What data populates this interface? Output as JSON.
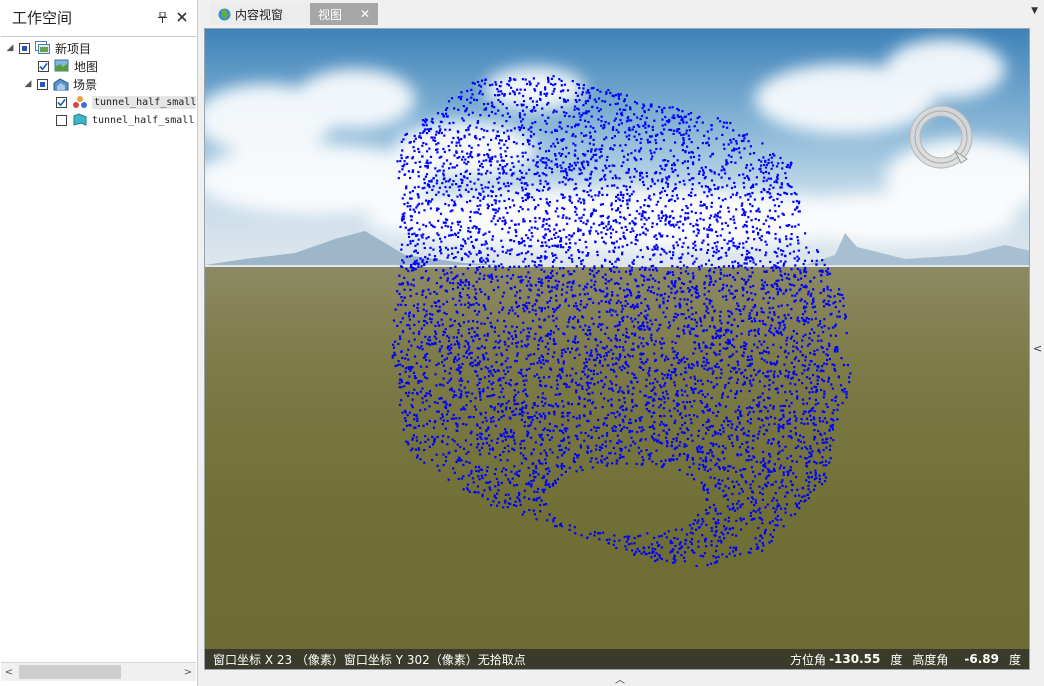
{
  "workspace": {
    "title": "工作空间",
    "pin_icon": "pin-icon",
    "close_icon": "close-icon"
  },
  "tree": {
    "project": "新项目",
    "map": "地图",
    "scene": "场景",
    "layer1": "tunnel_half_small",
    "layer2": "tunnel_half_small"
  },
  "tabs": {
    "content_view": "内容视窗",
    "view": "视图"
  },
  "status": {
    "left": "窗口坐标 X 23 （像素）窗口坐标 Y 302（像素）无拾取点",
    "azimuth_label": "方位角",
    "azimuth_value": "-130.55",
    "deg1": "度",
    "pitch_label": "高度角",
    "pitch_value": "-6.89",
    "deg2": "度"
  },
  "colors": {
    "point_cloud": "#0000ff",
    "status_bar": "#282828"
  }
}
